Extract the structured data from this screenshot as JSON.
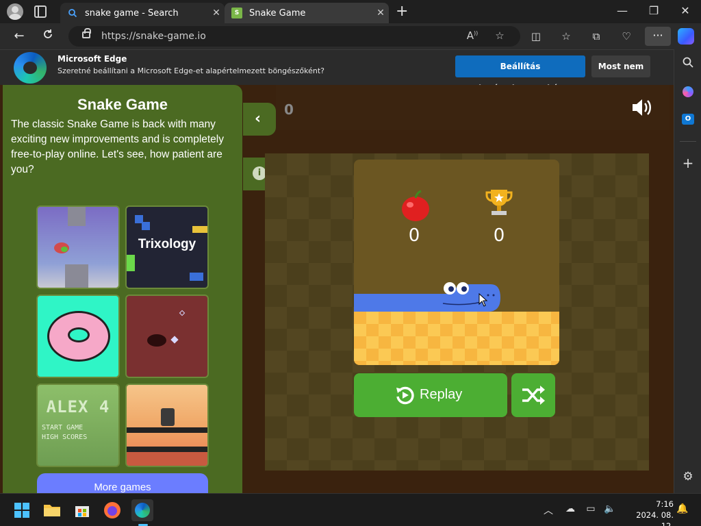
{
  "tabs": [
    {
      "title": "snake game - Search",
      "favicon": "search-icon"
    },
    {
      "title": "Snake Game",
      "favicon": "snake-game-favicon",
      "active": true
    }
  ],
  "address": {
    "url": "https://snake-game.io"
  },
  "infobar": {
    "title": "Microsoft Edge",
    "message": "Szeretné beállítani a Microsoft Edge-et alapértelmezett böngészőként?",
    "primary_label": "Beállítás alapértelmezettként",
    "secondary_label": "Most nem"
  },
  "left_panel": {
    "title": "Snake Game",
    "description": "The classic Snake Game is back with many exciting new improvements and is completely free-to-play online. Let's see, how patient are you?",
    "games": [
      {
        "name": "flappy-bird-game",
        "label": ""
      },
      {
        "name": "trixology-game",
        "label": "Trixology"
      },
      {
        "name": "donut-dots-game",
        "label": ""
      },
      {
        "name": "dark-shooter-game",
        "label": ""
      },
      {
        "name": "alex-game",
        "label": "ALEX 4"
      },
      {
        "name": "robot-platformer-game",
        "label": ""
      }
    ],
    "alex_menu": [
      "START GAME",
      "HIGH SCORES"
    ],
    "more_games_label": "More games"
  },
  "game": {
    "top_score": "0",
    "apples": "0",
    "best": "0",
    "replay_label": "Replay"
  },
  "taskbar": {
    "time": "7:16",
    "date": "2024. 08. 12."
  },
  "colors": {
    "accent_blue": "#0f6cbd",
    "panel_green": "#4b6a22",
    "button_green": "#4cae33",
    "snake_blue": "#4e79e8"
  }
}
